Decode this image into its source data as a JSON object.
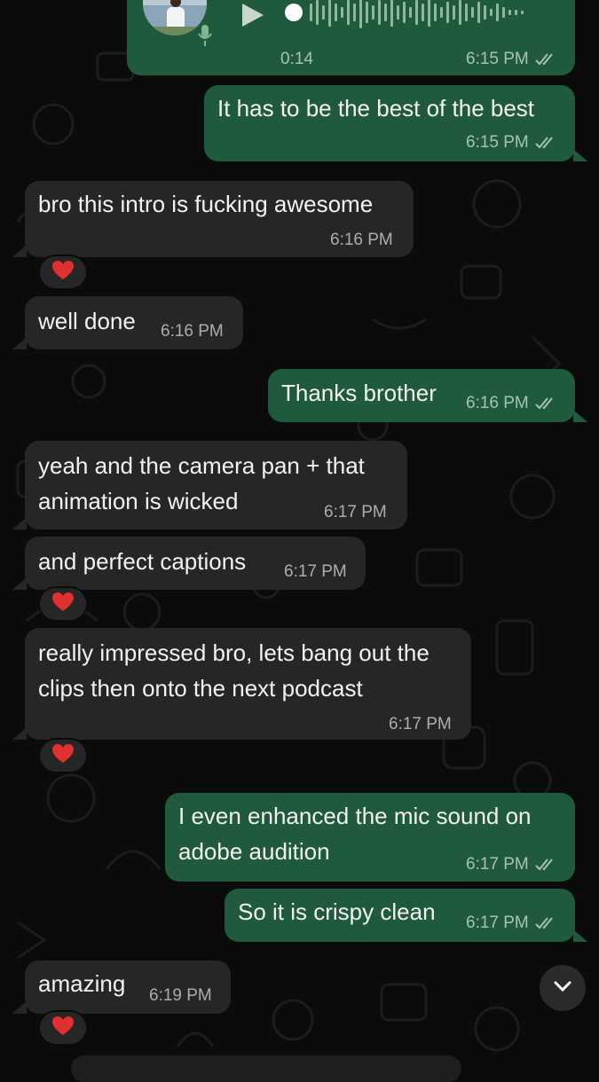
{
  "voice_note": {
    "duration": "0:14",
    "time": "6:15 PM",
    "status": "read"
  },
  "messages": [
    {
      "direction": "out",
      "text": "It has to be the best of the best",
      "time": "6:15 PM"
    },
    {
      "direction": "in",
      "text": "bro this intro is fucking awesome",
      "time": "6:16 PM",
      "reaction": "heart"
    },
    {
      "direction": "in",
      "text": "well done",
      "time": "6:16 PM"
    },
    {
      "direction": "out",
      "text": "Thanks brother",
      "time": "6:16 PM"
    },
    {
      "direction": "in",
      "lines": [
        "yeah and the camera pan + that",
        "animation is wicked"
      ],
      "time": "6:17 PM"
    },
    {
      "direction": "in",
      "text": "and perfect captions",
      "time": "6:17 PM",
      "reaction": "heart"
    },
    {
      "direction": "in",
      "lines": [
        "really impressed bro, lets bang out the",
        "clips then onto the next podcast"
      ],
      "time": "6:17 PM",
      "reaction": "heart"
    },
    {
      "direction": "out",
      "lines": [
        "I even enhanced the mic sound on",
        "adobe audition"
      ],
      "time": "6:17 PM"
    },
    {
      "direction": "out",
      "text": "So it is crispy clean",
      "time": "6:17 PM"
    },
    {
      "direction": "in",
      "text": "amazing",
      "time": "6:19 PM",
      "reaction": "heart"
    }
  ],
  "colors": {
    "outgoing_bubble": "#1f5a3c",
    "incoming_bubble": "#262626",
    "background": "#0b0b0b",
    "reaction_heart": "#e0302f"
  },
  "icons": {
    "play": "play-icon",
    "mic": "mic-icon",
    "read_receipt": "double-check-icon",
    "reaction": "heart-icon",
    "scroll_down": "chevron-down-icon"
  }
}
